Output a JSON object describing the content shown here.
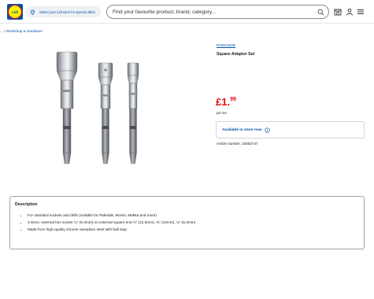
{
  "header": {
    "logo_text": "Lidl",
    "store_link": "Select your Lidl store for special offers",
    "search_placeholder": "Find your favourite product, brand, category...",
    "icons": [
      "store-icon",
      "user-icon",
      "menu-icon"
    ]
  },
  "breadcrumb": {
    "prefix": "... /",
    "current": "Workshop & Hardware"
  },
  "product": {
    "brand": "PARKSIDE",
    "title": "Square Adaptor Set",
    "price_main": "£1.",
    "price_decimals": "99",
    "price_unit": "per set",
    "availability": "Available in store now",
    "article_number": "Article number: 10053747"
  },
  "description": {
    "title": "Description",
    "items": [
      "For standard sockets and drills (suitable for Parkside, Bosch, Makita and more)",
      "3 sizes: external hex socket ¼\" (6.3mm) on external square end ½\" (12.5mm), ⅜\" (10mm), ¼\" (6.3mm)",
      "Made from high-quality chrome vanadium steel with ball stop"
    ]
  },
  "colors": {
    "brand_blue": "#0050aa",
    "brand_yellow": "#fff000",
    "price_red": "#e60a14"
  }
}
